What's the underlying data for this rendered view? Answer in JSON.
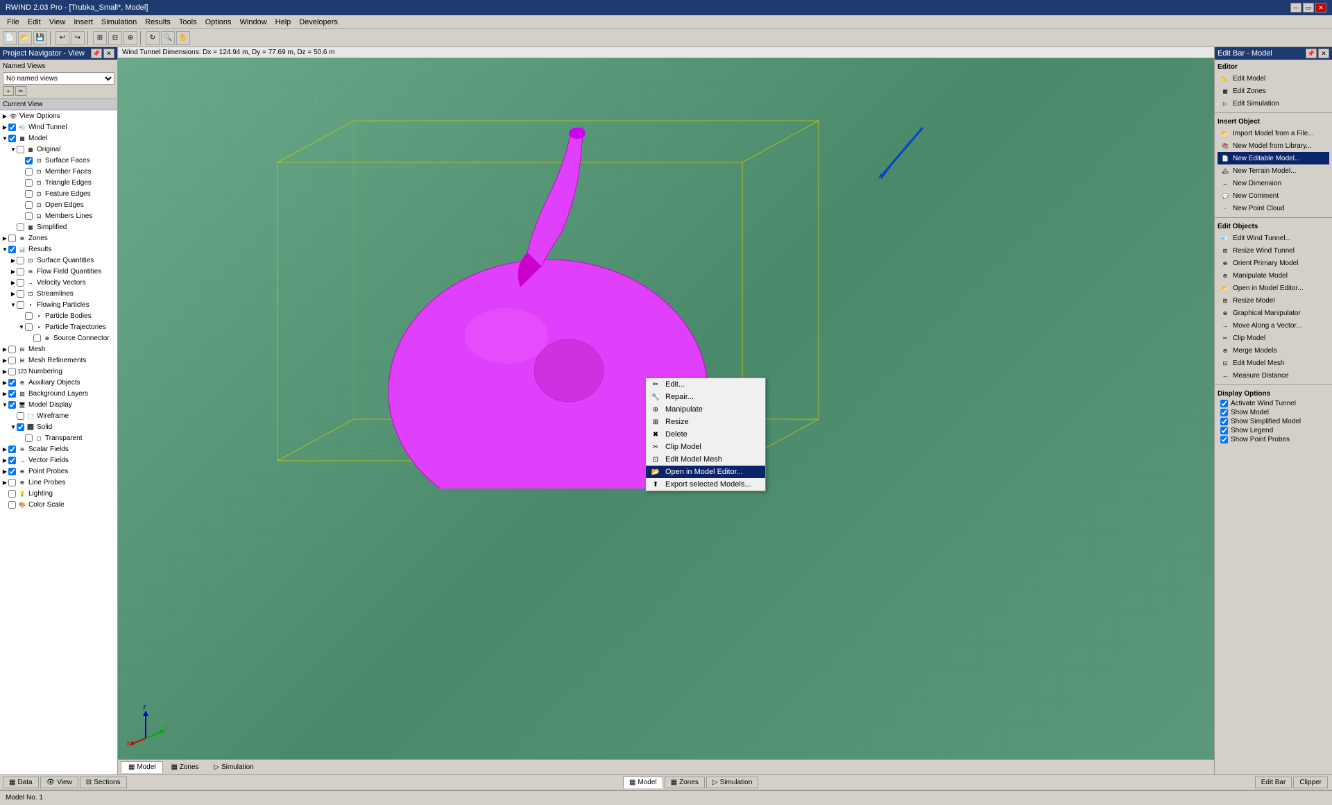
{
  "app": {
    "title": "RWIND 2.03 Pro - [Trubka_Small*, Model]",
    "window_controls": [
      "minimize",
      "restore",
      "close"
    ]
  },
  "menu": {
    "items": [
      "File",
      "Edit",
      "View",
      "Insert",
      "Simulation",
      "Results",
      "Tools",
      "Options",
      "Window",
      "Help",
      "Developers"
    ]
  },
  "left_panel": {
    "title": "Project Navigator - View",
    "named_views_label": "Named Views",
    "named_views_placeholder": "No named views",
    "current_view_label": "Current View",
    "tree": [
      {
        "id": "view-options",
        "label": "View Options",
        "level": 0,
        "expand": "▶",
        "has_checkbox": false
      },
      {
        "id": "wind-tunnel",
        "label": "Wind Tunnel",
        "level": 0,
        "expand": "▶",
        "has_checkbox": true,
        "checked": true
      },
      {
        "id": "model",
        "label": "Model",
        "level": 0,
        "expand": "▼",
        "has_checkbox": true,
        "checked": true
      },
      {
        "id": "original",
        "label": "Original",
        "level": 1,
        "expand": "▼",
        "has_checkbox": true,
        "checked": false
      },
      {
        "id": "surface-faces",
        "label": "Surface Faces",
        "level": 2,
        "expand": "",
        "has_checkbox": true,
        "checked": true
      },
      {
        "id": "member-faces",
        "label": "Member Faces",
        "level": 2,
        "expand": "",
        "has_checkbox": true,
        "checked": false
      },
      {
        "id": "triangle-edges",
        "label": "Triangle Edges",
        "level": 2,
        "expand": "",
        "has_checkbox": true,
        "checked": false
      },
      {
        "id": "feature-edges",
        "label": "Feature Edges",
        "level": 2,
        "expand": "",
        "has_checkbox": true,
        "checked": false
      },
      {
        "id": "open-edges",
        "label": "Open Edges",
        "level": 2,
        "expand": "",
        "has_checkbox": true,
        "checked": false
      },
      {
        "id": "members-lines",
        "label": "Members Lines",
        "level": 2,
        "expand": "",
        "has_checkbox": true,
        "checked": false
      },
      {
        "id": "simplified",
        "label": "Simplified",
        "level": 1,
        "expand": "",
        "has_checkbox": true,
        "checked": false
      },
      {
        "id": "zones",
        "label": "Zones",
        "level": 0,
        "expand": "▶",
        "has_checkbox": true,
        "checked": false
      },
      {
        "id": "results",
        "label": "Results",
        "level": 0,
        "expand": "▼",
        "has_checkbox": true,
        "checked": true
      },
      {
        "id": "surface-quantities",
        "label": "Surface Quantities",
        "level": 1,
        "expand": "▶",
        "has_checkbox": true,
        "checked": false
      },
      {
        "id": "flow-field",
        "label": "Flow Field Quantities",
        "level": 1,
        "expand": "▶",
        "has_checkbox": true,
        "checked": false
      },
      {
        "id": "velocity-vectors",
        "label": "Velocity Vectors",
        "level": 1,
        "expand": "▶",
        "has_checkbox": true,
        "checked": false
      },
      {
        "id": "streamlines",
        "label": "Streamlines",
        "level": 1,
        "expand": "▶",
        "has_checkbox": true,
        "checked": false
      },
      {
        "id": "flowing-particles",
        "label": "Flowing Particles",
        "level": 1,
        "expand": "▼",
        "has_checkbox": true,
        "checked": false
      },
      {
        "id": "particle-bodies",
        "label": "Particle Bodies",
        "level": 2,
        "expand": "",
        "has_checkbox": true,
        "checked": false
      },
      {
        "id": "particle-trajectories",
        "label": "Particle Trajectories",
        "level": 2,
        "expand": "▼",
        "has_checkbox": true,
        "checked": false
      },
      {
        "id": "source-connector",
        "label": "Source Connector",
        "level": 3,
        "expand": "",
        "has_checkbox": true,
        "checked": false
      },
      {
        "id": "mesh",
        "label": "Mesh",
        "level": 0,
        "expand": "▶",
        "has_checkbox": true,
        "checked": false
      },
      {
        "id": "mesh-refinements",
        "label": "Mesh Refinements",
        "level": 0,
        "expand": "▶",
        "has_checkbox": true,
        "checked": false
      },
      {
        "id": "numbering",
        "label": "Numbering",
        "level": 0,
        "expand": "▶",
        "has_checkbox": true,
        "checked": false
      },
      {
        "id": "auxiliary-objects",
        "label": "Auxiliary Objects",
        "level": 0,
        "expand": "▶",
        "has_checkbox": true,
        "checked": true
      },
      {
        "id": "background-layers",
        "label": "Background Layers",
        "level": 0,
        "expand": "▶",
        "has_checkbox": true,
        "checked": true
      },
      {
        "id": "model-display",
        "label": "Model Display",
        "level": 0,
        "expand": "▼",
        "has_checkbox": true,
        "checked": true
      },
      {
        "id": "wireframe",
        "label": "Wireframe",
        "level": 1,
        "expand": "",
        "has_checkbox": true,
        "checked": false
      },
      {
        "id": "solid",
        "label": "Solid",
        "level": 1,
        "expand": "▼",
        "has_checkbox": true,
        "checked": true
      },
      {
        "id": "transparent",
        "label": "Transparent",
        "level": 2,
        "expand": "",
        "has_checkbox": true,
        "checked": false
      },
      {
        "id": "scalar-fields",
        "label": "Scalar Fields",
        "level": 0,
        "expand": "▶",
        "has_checkbox": true,
        "checked": true
      },
      {
        "id": "vector-fields",
        "label": "Vector Fields",
        "level": 0,
        "expand": "▶",
        "has_checkbox": true,
        "checked": true
      },
      {
        "id": "point-probes",
        "label": "Point Probes",
        "level": 0,
        "expand": "▶",
        "has_checkbox": true,
        "checked": true
      },
      {
        "id": "line-probes",
        "label": "Line Probes",
        "level": 0,
        "expand": "▶",
        "has_checkbox": true,
        "checked": false
      },
      {
        "id": "lighting",
        "label": "Lighting",
        "level": 0,
        "expand": "",
        "has_checkbox": true,
        "checked": false
      },
      {
        "id": "color-scale",
        "label": "Color Scale",
        "level": 0,
        "expand": "",
        "has_checkbox": true,
        "checked": false
      }
    ]
  },
  "viewport": {
    "header": "Wind Tunnel Dimensions: Dx = 124.94 m, Dy = 77.69 m, Dz = 50.6 m"
  },
  "context_menu": {
    "items": [
      {
        "id": "edit",
        "label": "Edit...",
        "icon": "✏️"
      },
      {
        "id": "repair",
        "label": "Repair...",
        "icon": "🔧"
      },
      {
        "id": "manipulate",
        "label": "Manipulate",
        "icon": "⊕"
      },
      {
        "id": "resize",
        "label": "Resize",
        "icon": "⊞"
      },
      {
        "id": "delete",
        "label": "Delete",
        "icon": "✖"
      },
      {
        "id": "clip-model",
        "label": "Clip Model",
        "icon": "✂"
      },
      {
        "id": "edit-model-mesh",
        "label": "Edit Model Mesh",
        "icon": "⊡"
      },
      {
        "id": "open-model-editor",
        "label": "Open in Model Editor...",
        "icon": "⊞",
        "active": true
      },
      {
        "id": "export-models",
        "label": "Export selected Models...",
        "icon": "⬆"
      }
    ]
  },
  "right_panel": {
    "title": "Edit Bar - Model",
    "editor_section_title": "Editor",
    "editor_items": [
      {
        "id": "edit-model",
        "label": "Edit Model",
        "icon": "📐"
      },
      {
        "id": "edit-zones",
        "label": "Edit Zones",
        "icon": "▦"
      },
      {
        "id": "edit-simulation",
        "label": "Edit Simulation",
        "icon": "▷"
      }
    ],
    "insert_section_title": "Insert Object",
    "insert_items": [
      {
        "id": "import-model",
        "label": "Import Model from a File...",
        "icon": "📂"
      },
      {
        "id": "new-model-library",
        "label": "New Model from Library...",
        "icon": "📚"
      },
      {
        "id": "new-editable-model",
        "label": "New Editable Model...",
        "icon": "📄",
        "highlighted": true
      },
      {
        "id": "new-terrain-model",
        "label": "New Terrain Model...",
        "icon": "🏔"
      },
      {
        "id": "new-dimension",
        "label": "New Dimension",
        "icon": "↔"
      },
      {
        "id": "new-comment",
        "label": "New Comment",
        "icon": "💬"
      },
      {
        "id": "new-point-cloud",
        "label": "New Point Cloud",
        "icon": "·"
      }
    ],
    "edit_objects_section_title": "Edit Objects",
    "edit_objects_items": [
      {
        "id": "edit-wind-tunnel",
        "label": "Edit Wind Tunnel...",
        "icon": "💨"
      },
      {
        "id": "resize-wind-tunnel",
        "label": "Resize Wind Tunnel",
        "icon": "⊞"
      },
      {
        "id": "orient-primary-model",
        "label": "Orient Primary Model",
        "icon": "⊕"
      },
      {
        "id": "manipulate-model",
        "label": "Manipulate Model",
        "icon": "⊕"
      },
      {
        "id": "open-model-editor2",
        "label": "Open in Model Editor...",
        "icon": "📂"
      },
      {
        "id": "resize-model",
        "label": "Resize Model",
        "icon": "⊞"
      },
      {
        "id": "graphical-manipulator",
        "label": "Graphical Manipulator",
        "icon": "⊕"
      },
      {
        "id": "move-along-vector",
        "label": "Move Along a Vector...",
        "icon": "→"
      },
      {
        "id": "clip-model2",
        "label": "Clip Model",
        "icon": "✂"
      },
      {
        "id": "merge-models",
        "label": "Merge Models",
        "icon": "⊕"
      },
      {
        "id": "edit-model-mesh2",
        "label": "Edit Model Mesh",
        "icon": "⊡"
      },
      {
        "id": "measure-distance",
        "label": "Measure Distance",
        "icon": "↔"
      }
    ],
    "display_section_title": "Display Options",
    "display_items": [
      {
        "id": "activate-wind-tunnel",
        "label": "Activate Wind Tunnel",
        "icon": "☑",
        "checked": true
      },
      {
        "id": "show-model",
        "label": "Show Model",
        "icon": "☑",
        "checked": true
      },
      {
        "id": "show-simplified",
        "label": "Show Simplified Model",
        "icon": "☑",
        "checked": true
      },
      {
        "id": "show-legend",
        "label": "Show Legend",
        "icon": "☑",
        "checked": true
      },
      {
        "id": "show-point-probes",
        "label": "Show Point Probes",
        "icon": "☑",
        "checked": true
      }
    ]
  },
  "bottom_tabs": {
    "viewport_tabs": [
      {
        "id": "model",
        "label": "Model",
        "active": true,
        "icon": "▦"
      },
      {
        "id": "zones",
        "label": "Zones",
        "active": false,
        "icon": "▦"
      },
      {
        "id": "simulation",
        "label": "Simulation",
        "active": false,
        "icon": "▷"
      }
    ],
    "panel_tabs": [
      {
        "id": "data",
        "label": "Data",
        "active": false,
        "icon": "▦"
      },
      {
        "id": "view",
        "label": "View",
        "active": false,
        "icon": "👁"
      },
      {
        "id": "sections",
        "label": "Sections",
        "active": false,
        "icon": "⊟"
      }
    ],
    "right_tabs": [
      {
        "id": "edit-bar",
        "label": "Edit Bar",
        "active": false
      },
      {
        "id": "clipper",
        "label": "Clipper",
        "active": false
      }
    ]
  },
  "status_bar": {
    "text": "Model No. 1"
  }
}
